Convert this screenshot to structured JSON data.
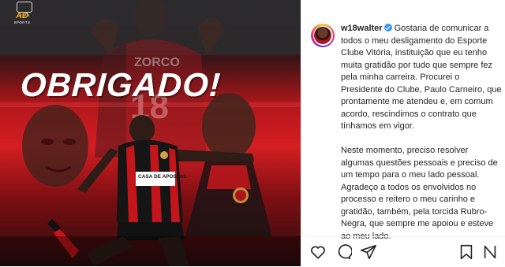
{
  "post_image": {
    "headline": "OBRIGADO!",
    "logo_top_text": "LIMA",
    "logo_badge_text": "AD",
    "logo_badge_subtext": "SPORTS",
    "jersey_name": "ZORCO",
    "jersey_number": "18",
    "sponsor_text": "CASA DE APOSTAS"
  },
  "post": {
    "username": "w18walter",
    "verified": true,
    "caption_paragraphs": [
      "Gostaria de comunicar a todos o meu desligamento do Esporte Clube Vitória, instituição que eu tenho muita gratidão por tudo que sempre fez pela minha carreira. Procurei o Presidente do Clube, Paulo Carneiro, que prontamente me atendeu e, em comum acordo, rescindimos o contrato que tínhamos em vigor.",
      "Neste momento, preciso resolver algumas questões pessoais e preciso de um tempo para o meu lado pessoal. Agradeço a todos os envolvidos no processo e reitero o meu carinho e gratidão, também, pela torcida Rubro-Negra, que sempre me apoiou e esteve ao meu lado."
    ]
  },
  "actions": {
    "icons": [
      "heart-icon",
      "comment-icon",
      "share-icon",
      "bookmark-icon"
    ],
    "more_icon": "more-icon"
  },
  "colors": {
    "accent_red": "#d41e22",
    "verified_blue": "#3897f0",
    "text": "#262626"
  }
}
